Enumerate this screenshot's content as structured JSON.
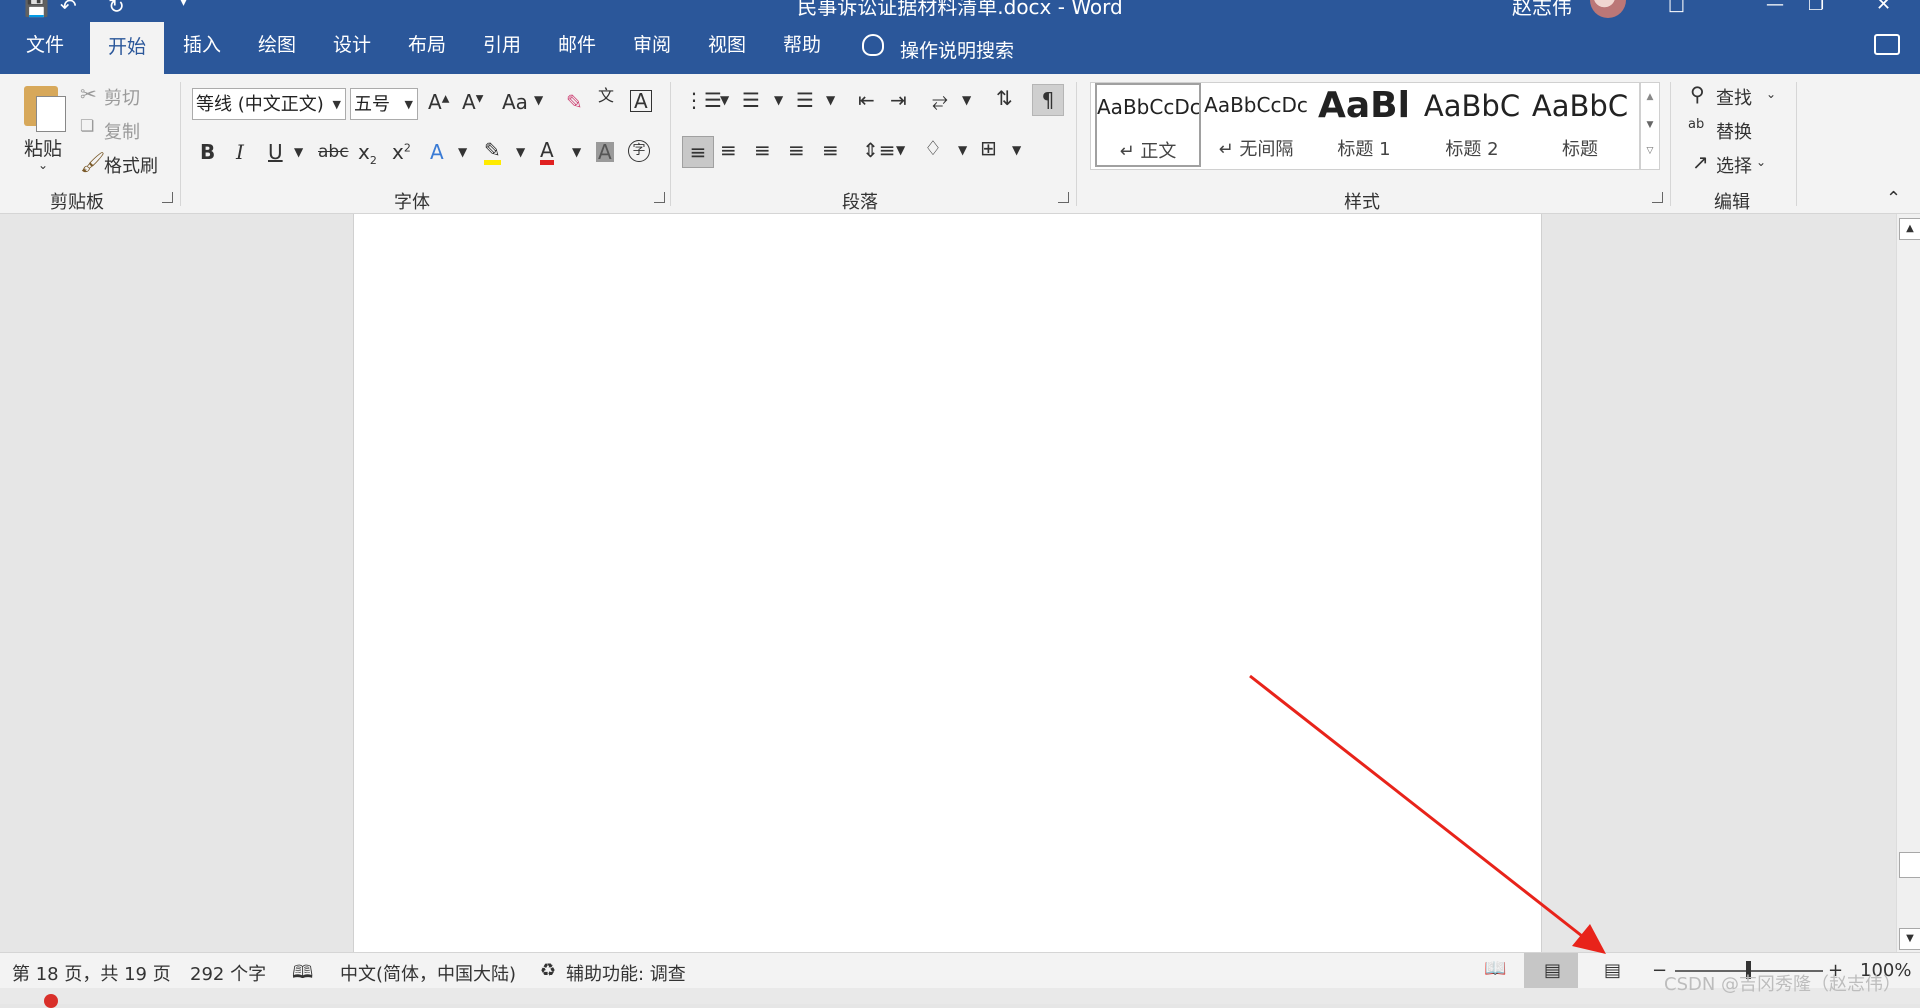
{
  "window": {
    "title": "民事诉讼证据材料清单.docx  -  Word",
    "user": "赵志伟"
  },
  "tabs": [
    "文件",
    "开始",
    "插入",
    "绘图",
    "设计",
    "布局",
    "引用",
    "邮件",
    "审阅",
    "视图",
    "帮助"
  ],
  "active_tab": "开始",
  "tell_me": "操作说明搜索",
  "clipboard": {
    "paste": "粘贴",
    "cut": "剪切",
    "copy": "复制",
    "format_painter": "格式刷",
    "group_label": "剪贴板"
  },
  "font": {
    "font_name": "等线 (中文正文)",
    "font_size": "五号",
    "change_case": "Aa",
    "group_label": "字体"
  },
  "paragraph": {
    "group_label": "段落"
  },
  "styles": {
    "items": [
      {
        "preview": "AaBbCcDc",
        "name": "正文",
        "mark": "↵"
      },
      {
        "preview": "AaBbCcDc",
        "name": "无间隔",
        "mark": "↵"
      },
      {
        "preview": "AaBl",
        "name": "标题 1"
      },
      {
        "preview": "AaBbC",
        "name": "标题 2"
      },
      {
        "preview": "AaBbC",
        "name": "标题"
      }
    ],
    "group_label": "样式"
  },
  "editing": {
    "find": "查找",
    "replace": "替换",
    "select": "选择",
    "group_label": "编辑"
  },
  "status": {
    "page": "第 18 页，共 19 页",
    "words": "292 个字",
    "language": "中文(简体，中国大陆)",
    "accessibility": "辅助功能: 调查",
    "zoom": "100%"
  },
  "watermark": "CSDN @吉冈秀隆（赵志伟）",
  "accent": "#2b579a",
  "arrow_color": "#e8231a"
}
